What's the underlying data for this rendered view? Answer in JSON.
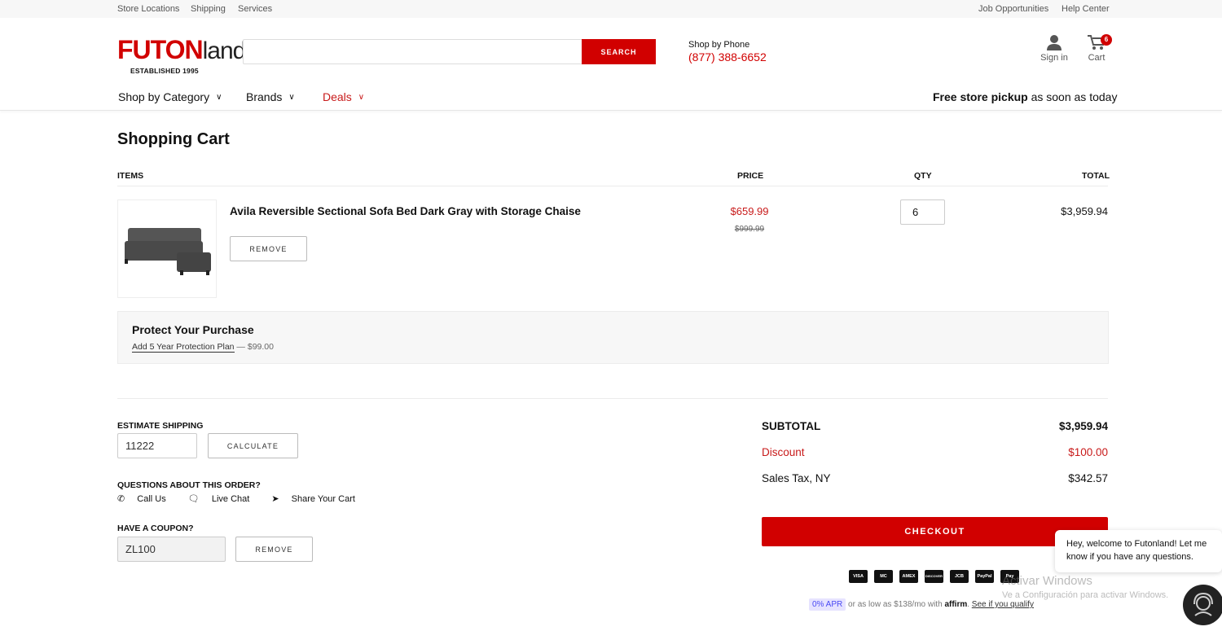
{
  "topbar": {
    "left_links": [
      "Store Locations",
      "Shipping",
      "Services"
    ],
    "right_links": [
      "Job Opportunities",
      "Help Center"
    ]
  },
  "logo": {
    "brand_red": "FUTON",
    "brand_black": "land",
    "established": "ESTABLISHED 1995"
  },
  "search": {
    "placeholder": "",
    "button": "SEARCH"
  },
  "phone": {
    "label": "Shop by Phone",
    "number": "(877) 388-6652"
  },
  "account": {
    "signin": "Sign in",
    "cart": "Cart",
    "cart_count": "6"
  },
  "nav": {
    "items": [
      "Shop by Category",
      "Brands",
      "Deals"
    ],
    "pickup_bold": "Free store pickup",
    "pickup_rest": " as soon as today"
  },
  "cart": {
    "title": "Shopping Cart",
    "headers": {
      "items": "ITEMS",
      "price": "PRICE",
      "qty": "QTY",
      "total": "TOTAL"
    },
    "item": {
      "name": "Avila Reversible Sectional Sofa Bed Dark Gray with Storage Chaise",
      "remove": "REMOVE",
      "price": "$659.99",
      "old_price": "$999.99",
      "qty": "6",
      "total": "$3,959.94"
    },
    "protect": {
      "title": "Protect Your Purchase",
      "link": "Add 5 Year Protection Plan",
      "suffix": " — $99.00"
    }
  },
  "shipping": {
    "label": "ESTIMATE SHIPPING",
    "zip": "11222",
    "button": "CALCULATE"
  },
  "questions": {
    "label": "QUESTIONS ABOUT THIS ORDER?",
    "call": "Call Us",
    "chat": "Live Chat",
    "share": "Share Your Cart"
  },
  "coupon": {
    "label": "HAVE A COUPON?",
    "code": "ZL100",
    "button": "REMOVE"
  },
  "summary": {
    "subtotal_label": "SUBTOTAL",
    "subtotal": "$3,959.94",
    "discount_label": "Discount",
    "discount": "$100.00",
    "tax_label": "Sales Tax, NY",
    "tax": "$342.57",
    "checkout": "CHECKOUT"
  },
  "payments": [
    "VISA",
    "MC",
    "AMEX",
    "DISCOVER",
    "JCB",
    "PayPal",
    "Pay"
  ],
  "affirm": {
    "apr": "0% APR",
    "text": "or as low as $138/mo with",
    "brand": "affirm",
    "link": "See if you qualify"
  },
  "chat": {
    "message": "Hey, welcome to Futonland! Let me know if you have any questions."
  },
  "watermark": {
    "line1": "Activar Windows",
    "line2": "Ve a Configuración para activar Windows."
  },
  "colors": {
    "brand_red": "#d10000",
    "price_red": "#c81a1a"
  }
}
